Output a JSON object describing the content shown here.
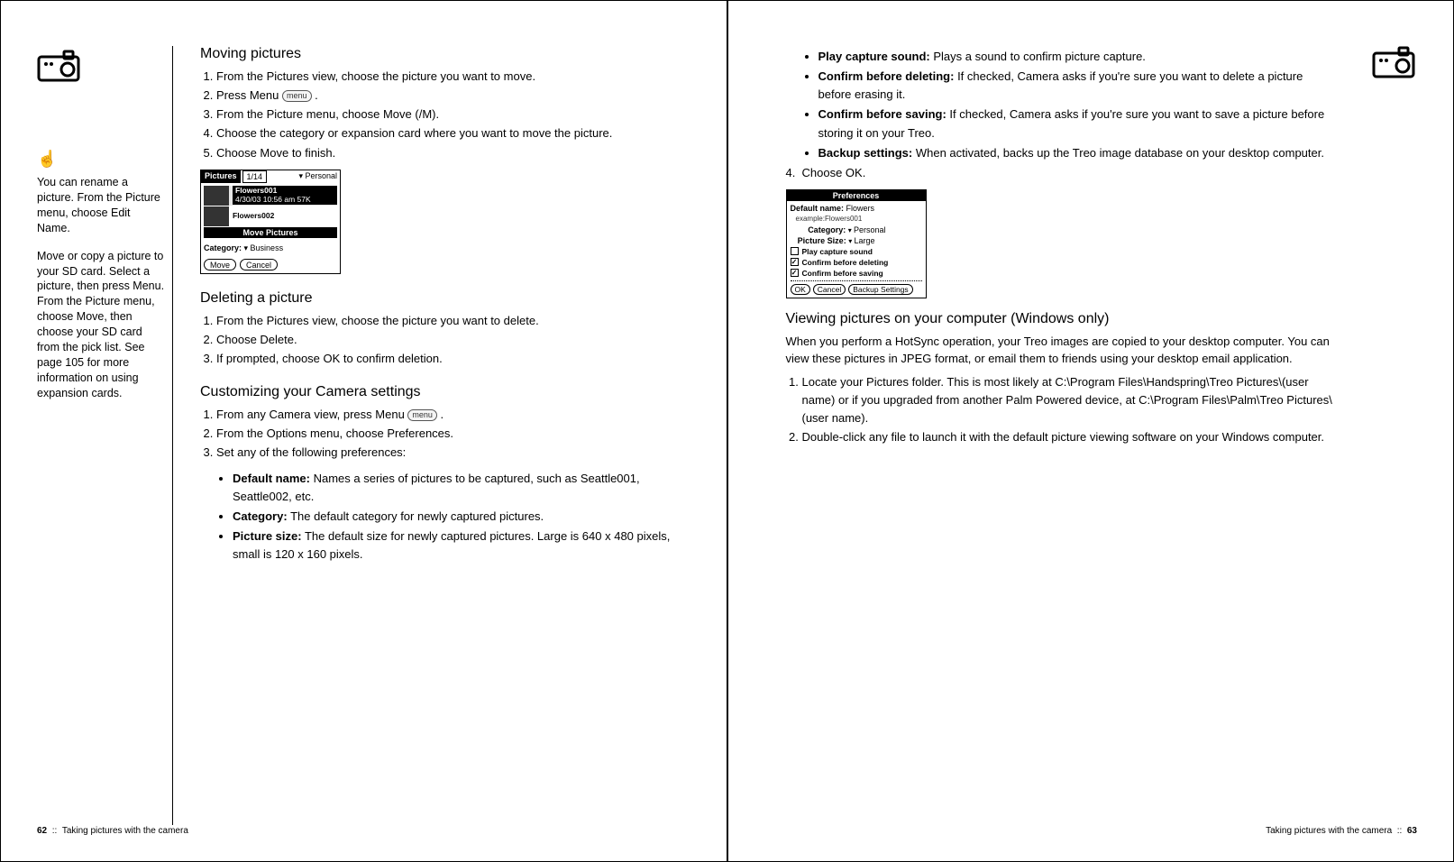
{
  "left_page": {
    "sidebar": {
      "tip1": "You can rename a picture. From the Picture menu, choose Edit Name.",
      "tip2": "Move or copy a picture to your SD card. Select a picture, then press Menu. From the Picture menu, choose Move, then choose your SD card from the pick list. See page 105 for more information on using expansion cards."
    },
    "section_moving": {
      "title": "Moving pictures",
      "steps": [
        "From the Pictures view, choose the picture you want to move.",
        "Press Menu ",
        "From the Picture menu, choose Move (/M).",
        "Choose the category or expansion card where you want to move the picture.",
        "Choose Move to finish."
      ],
      "menu_label": "menu"
    },
    "shot1": {
      "title": "Pictures",
      "count": "1/14",
      "category_dropdown": "Personal",
      "item1_name": "Flowers001",
      "item1_meta": "4/30/03 10:56 am 57K",
      "item2_name": "Flowers002",
      "move_header": "Move Pictures",
      "cat_label": "Category:",
      "cat_value": "Business",
      "btn_move": "Move",
      "btn_cancel": "Cancel"
    },
    "section_deleting": {
      "title": "Deleting a picture",
      "steps": [
        "From the Pictures view, choose the picture you want to delete.",
        "Choose Delete.",
        "If prompted, choose OK to confirm deletion."
      ]
    },
    "section_customizing": {
      "title": "Customizing your Camera settings",
      "steps": [
        "From any Camera view, press Menu ",
        "From the Options menu, choose Preferences.",
        "Set any of the following preferences:"
      ],
      "menu_label": "menu",
      "prefs": [
        {
          "label": "Default name:",
          "text": " Names a series of pictures to be captured, such as Seattle001, Seattle002, etc."
        },
        {
          "label": "Category:",
          "text": " The default category for newly captured pictures."
        },
        {
          "label": "Picture size:",
          "text": " The default size for newly captured pictures. Large is 640 x 480 pixels, small is 120 x 160 pixels."
        }
      ]
    },
    "footer": {
      "page_num": "62",
      "sep": "::",
      "title": "Taking pictures with the camera"
    }
  },
  "right_page": {
    "continued_prefs": [
      {
        "label": "Play capture sound:",
        "text": " Plays a sound to confirm picture capture."
      },
      {
        "label": "Confirm before deleting:",
        "text": " If checked, Camera asks if you're sure you want to delete a picture before erasing it."
      },
      {
        "label": "Confirm before saving:",
        "text": " If checked, Camera asks if you're sure you want to save a picture before storing it on your Treo."
      },
      {
        "label": "Backup settings:",
        "text": " When activated, backs up the Treo image database on your desktop computer."
      }
    ],
    "step4": "Choose OK.",
    "shot2": {
      "title": "Preferences",
      "default_name_label": "Default name:",
      "default_name_value": "Flowers",
      "example": "example:Flowers001",
      "category_label": "Category:",
      "category_value": "Personal",
      "size_label": "Picture Size:",
      "size_value": "Large",
      "chk_play": "Play capture sound",
      "chk_del": "Confirm before deleting",
      "chk_save": "Confirm before saving",
      "btn_ok": "OK",
      "btn_cancel": "Cancel",
      "btn_backup": "Backup Settings"
    },
    "section_viewing": {
      "title": "Viewing pictures on your computer (Windows only)",
      "intro": "When you perform a HotSync operation, your Treo images are copied to your desktop computer. You can view these pictures in JPEG format, or email them to friends using your desktop email application.",
      "steps": [
        "Locate your Pictures folder. This is most likely at C:\\Program Files\\Handspring\\Treo Pictures\\(user name) or if you upgraded from another Palm Powered device, at C:\\Program Files\\Palm\\Treo Pictures\\(user name).",
        "Double-click any file to launch it with the default picture viewing software on your Windows computer."
      ]
    },
    "footer": {
      "title": "Taking pictures with the camera",
      "sep": "::",
      "page_num": "63"
    }
  }
}
